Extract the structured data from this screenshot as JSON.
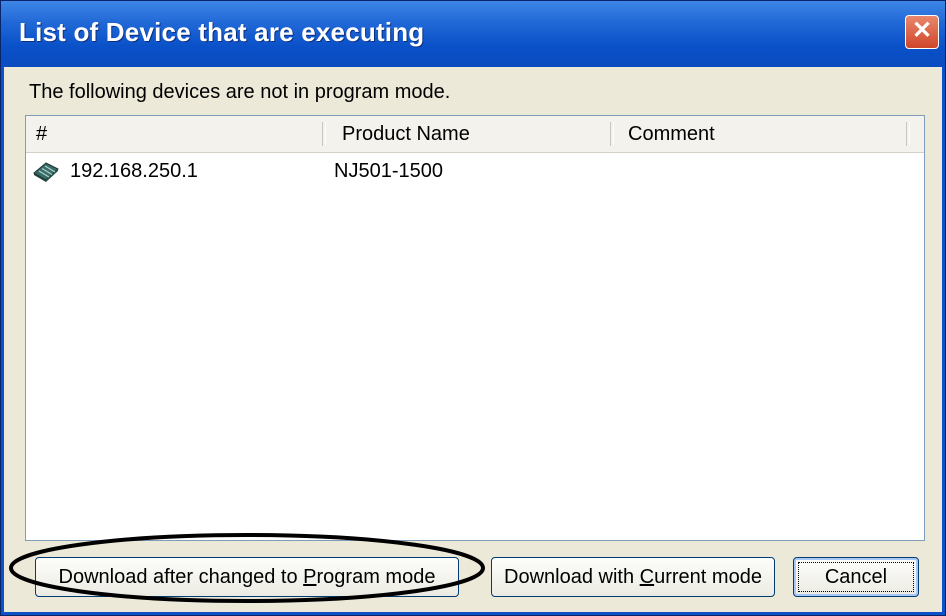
{
  "window": {
    "title": "List of Device that are executing",
    "close_symbol": "✕"
  },
  "message": "The following devices are not in program mode.",
  "list": {
    "columns": [
      "#",
      "Product Name",
      "Comment"
    ],
    "rows": [
      {
        "address": "192.168.250.1",
        "product_name": "NJ501-1500",
        "comment": "",
        "icon": "plc-device-icon"
      }
    ]
  },
  "buttons": {
    "download_program_mode": {
      "pre": "Download after changed to ",
      "mnemonic": "P",
      "post": "rogram mode"
    },
    "download_current_mode": {
      "pre": "Download with ",
      "mnemonic": "C",
      "post": "urrent mode"
    },
    "cancel": "Cancel"
  },
  "colors": {
    "titlebar": "#0a50c8",
    "dialog_face": "#ece9d8",
    "close_button": "#d0462a",
    "callout_ellipse": "#000000"
  }
}
